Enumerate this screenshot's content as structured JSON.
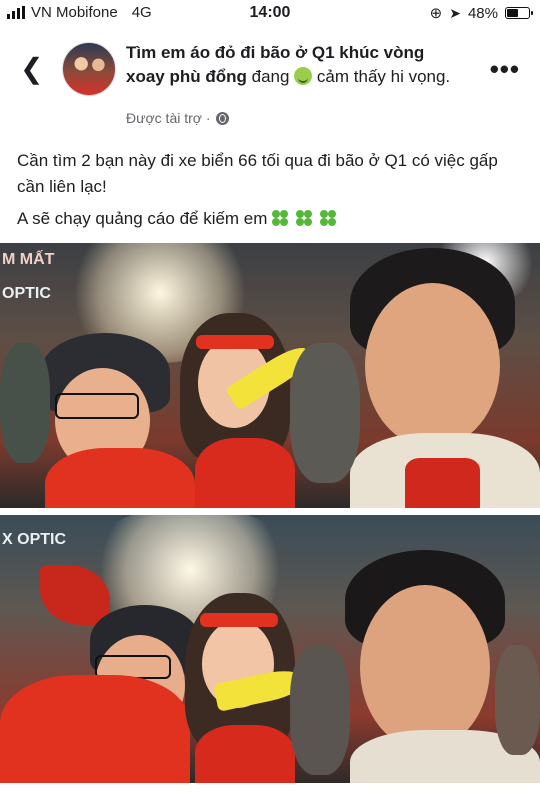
{
  "status_bar": {
    "carrier": "VN Mobifone",
    "network": "4G",
    "time": "14:00",
    "battery": "48%",
    "battery_level": 0.48
  },
  "post": {
    "page_name": "Tìm em áo đỏ đi bão ở Q1 khúc vòng xoay phù đổng",
    "activity_prefix": "đang",
    "activity_suffix": "cảm thấy hi vọng.",
    "sponsored_label": "Được tài trợ ·",
    "body_line1": "Cần tìm 2 bạn này đi xe biển 66 tối qua đi bão ở Q1 có việc gấp cần liên lạc!",
    "body_line2": "A sẽ chạy quảng cáo để kiếm em",
    "photo1_sign_left": "OPTIC",
    "photo1_sign_top": "M MẤT",
    "photo2_sign_left": "X OPTIC"
  },
  "icons": {
    "back": "back-arrow-icon",
    "more": "more-options-icon",
    "globe": "globe-icon",
    "emoji": "relieved-face-emoji-icon",
    "clover": "four-leaf-clover-icon"
  },
  "colors": {
    "text": "#1c1e21",
    "secondary": "#65676b",
    "jersey_red": "#e0321f",
    "vuvuzela_yellow": "#f2e23a"
  }
}
